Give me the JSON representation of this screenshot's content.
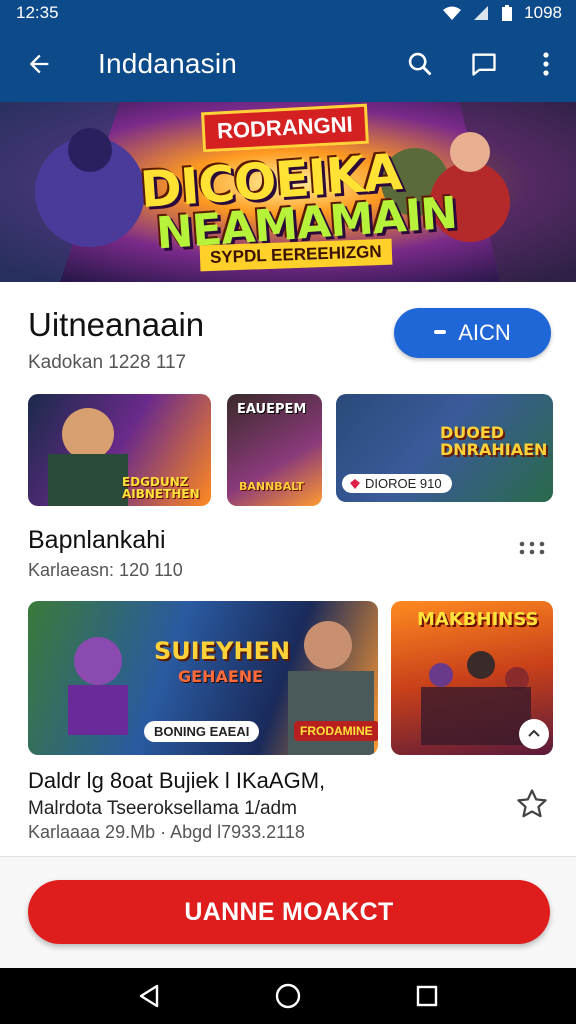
{
  "status_bar": {
    "time": "12:35",
    "battery": "1098"
  },
  "app_bar": {
    "title": "Inddanasin"
  },
  "banner": {
    "top_label": "RODRANGNI",
    "title_line1": "DICOEIKA",
    "title_line2": "NEAMAMAIN",
    "subtitle": "SYPDL EEREEHIZGN"
  },
  "section1": {
    "title": "Uitneanaain",
    "subtitle": "Kadokan 1228 117",
    "action_label": "AICN",
    "thumbs": [
      {
        "label": "EDGDUNZ\nAIBNETHEN"
      },
      {
        "label": "EAUEPEM",
        "label2": "BANNBALT"
      },
      {
        "label": "DUOED\nDNRAHIAEN",
        "badge": "DIOROE 910"
      }
    ]
  },
  "section2": {
    "title": "Bapnlankahi",
    "subtitle": "Karlaeasn: 120 110",
    "cards": [
      {
        "title": "SUIEYHEN",
        "tag": "GEHAENE",
        "badge1": "BONING EAEAI",
        "badge2": "FRODAMINE"
      },
      {
        "title": "MAKBHINSS"
      }
    ],
    "desc_line1": "Daldr lg 8oat Bujiek l IKaAGM,",
    "desc_line2": "Malrdota Tseeroksellama 1/adm",
    "desc_line3": "Karlaaaa 29.Mb · Abgd l7933.2118"
  },
  "cta": {
    "label": "UANNE MOAKCT"
  },
  "colors": {
    "primary": "#0d4a8a",
    "action": "#1f66d6",
    "cta": "#df1d1d"
  },
  "icons": [
    "back-arrow-icon",
    "search-icon",
    "chat-icon",
    "more-vert-icon",
    "more-horiz-icon",
    "star-outline-icon",
    "nav-back-icon",
    "nav-home-icon",
    "nav-recents-icon"
  ]
}
